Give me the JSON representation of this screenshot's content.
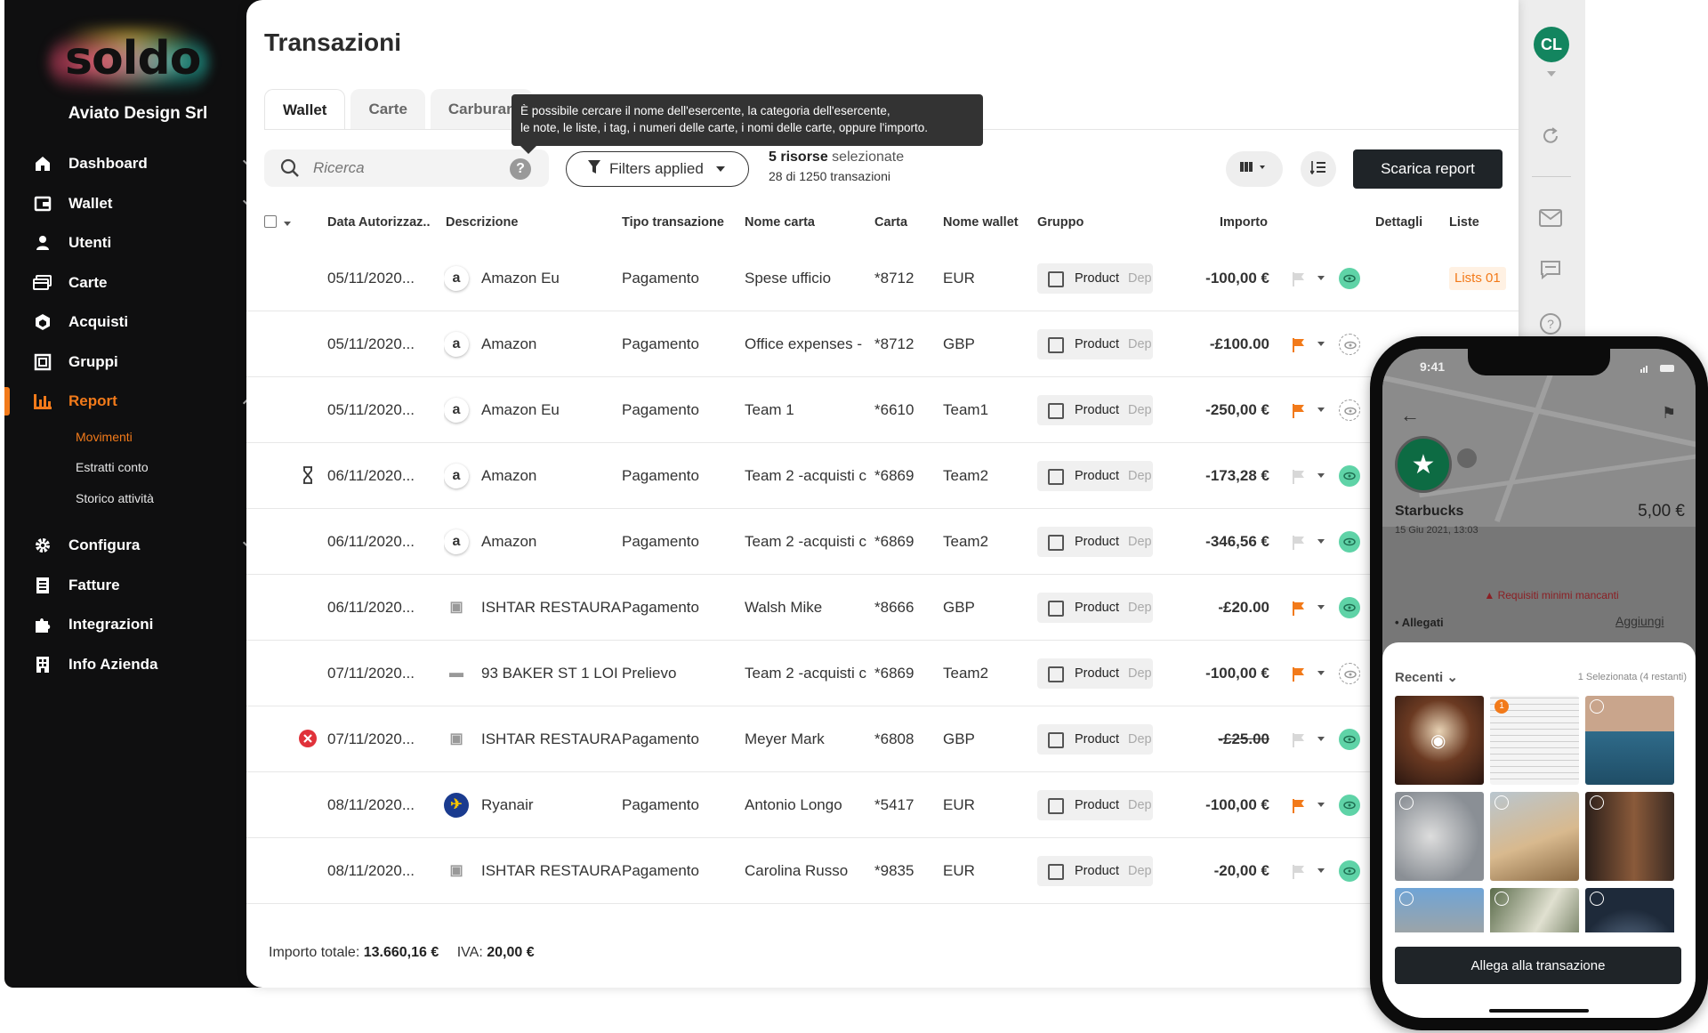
{
  "brand": {
    "logo_text": "soldo",
    "company": "Aviato Design Srl",
    "accent": "#f27a1a"
  },
  "nav": {
    "items": [
      {
        "label": "Dashboard"
      },
      {
        "label": "Wallet"
      },
      {
        "label": "Utenti"
      },
      {
        "label": "Carte"
      },
      {
        "label": "Acquisti"
      },
      {
        "label": "Gruppi"
      },
      {
        "label": "Report"
      },
      {
        "label": "Configura"
      },
      {
        "label": "Fatture"
      },
      {
        "label": "Integrazioni"
      },
      {
        "label": "Info Azienda"
      }
    ],
    "report_sub": [
      {
        "label": "Movimenti"
      },
      {
        "label": "Estratti conto"
      },
      {
        "label": "Storico attività"
      }
    ]
  },
  "page": {
    "title": "Transazioni"
  },
  "tabs": [
    {
      "label": "Wallet"
    },
    {
      "label": "Carte"
    },
    {
      "label": "Carburan"
    }
  ],
  "tooltip": {
    "line1": "È possibile cercare il nome dell'esercente, la categoria dell'esercente,",
    "line2": "le note, le liste, i tag, i numeri delle carte, i nomi delle carte, oppure l'importo."
  },
  "toolbar": {
    "search_placeholder": "Ricerca",
    "help": "?",
    "filters": "Filters applied",
    "resources_count": "5 risorse",
    "resources_suffix": " selezionate",
    "tx_count": "28 di 1250 transazioni",
    "download": "Scarica report"
  },
  "columns": {
    "date": "Data Autorizzaz..",
    "desc": "Descrizione",
    "type": "Tipo transazione",
    "card_name": "Nome carta",
    "card": "Carta",
    "wallet": "Nome wallet",
    "group": "Gruppo",
    "amount": "Importo",
    "details": "Dettagli",
    "lists": "Liste"
  },
  "rows": [
    {
      "status": "",
      "date": "05/11/2020...",
      "icon": "a",
      "merchant": "Amazon Eu",
      "type": "Pagamento",
      "card_name": "Spese ufficio",
      "card": "*8712",
      "wallet": "EUR",
      "group": "Product",
      "group2": "Dep",
      "amount": "-100,00 €",
      "flag": "grey",
      "receipt": "green",
      "list": "Lists 01"
    },
    {
      "status": "",
      "date": "05/11/2020...",
      "icon": "a",
      "merchant": "Amazon",
      "type": "Pagamento",
      "card_name": "Office expenses - ",
      "card": "*8712",
      "wallet": "GBP",
      "group": "Product",
      "group2": "Dep",
      "amount": "-£100.00",
      "flag": "orange",
      "receipt": "outline",
      "list": ""
    },
    {
      "status": "",
      "date": "05/11/2020...",
      "icon": "a",
      "merchant": "Amazon Eu",
      "type": "Pagamento",
      "card_name": "Team 1",
      "card": "*6610",
      "wallet": "Team1",
      "group": "Product",
      "group2": "Dep",
      "amount": "-250,00 €",
      "flag": "orange",
      "receipt": "outline",
      "list": ""
    },
    {
      "status": "hourglass",
      "date": "06/11/2020...",
      "icon": "a",
      "merchant": "Amazon",
      "type": "Pagamento",
      "card_name": "Team 2 -acquisti c",
      "card": "*6869",
      "wallet": "Team2",
      "group": "Product",
      "group2": "Dep",
      "amount": "-173,28 €",
      "flag": "grey",
      "receipt": "green",
      "list": ""
    },
    {
      "status": "",
      "date": "06/11/2020...",
      "icon": "a",
      "merchant": "Amazon",
      "type": "Pagamento",
      "card_name": "Team 2 -acquisti c",
      "card": "*6869",
      "wallet": "Team2",
      "group": "Product",
      "group2": "Dep",
      "amount": "-346,56 €",
      "flag": "grey",
      "receipt": "green",
      "list": ""
    },
    {
      "status": "",
      "date": "06/11/2020...",
      "icon": "restaurant",
      "merchant": "ISHTAR RESTAURA",
      "type": "Pagamento",
      "card_name": "Walsh Mike",
      "card": "*8666",
      "wallet": "GBP",
      "group": "Product",
      "group2": "Dep",
      "amount": "-£20.00",
      "flag": "orange",
      "receipt": "green",
      "list": ""
    },
    {
      "status": "",
      "date": "07/11/2020...",
      "icon": "cash",
      "merchant": "93 BAKER ST 1 LOI",
      "type": "Prelievo",
      "card_name": "Team 2 -acquisti c",
      "card": "*6869",
      "wallet": "Team2",
      "group": "Product",
      "group2": "Dep",
      "amount": "-100,00 €",
      "flag": "orange",
      "receipt": "outline",
      "list": ""
    },
    {
      "status": "error",
      "date": "07/11/2020...",
      "icon": "restaurant",
      "merchant": "ISHTAR RESTAURA",
      "type": "Pagamento",
      "card_name": "Meyer Mark",
      "card": "*6808",
      "wallet": "GBP",
      "group": "Product",
      "group2": "Dep",
      "amount": "-£25.00",
      "flag": "grey",
      "receipt": "green",
      "list": ""
    },
    {
      "status": "",
      "date": "08/11/2020...",
      "icon": "ryanair",
      "merchant": "Ryanair",
      "type": "Pagamento",
      "card_name": "Antonio Longo",
      "card": "*5417",
      "wallet": "EUR",
      "group": "Product",
      "group2": "Dep",
      "amount": "-100,00 €",
      "flag": "orange",
      "receipt": "green",
      "list": ""
    },
    {
      "status": "",
      "date": "08/11/2020...",
      "icon": "restaurant",
      "merchant": "ISHTAR RESTAURA",
      "type": "Pagamento",
      "card_name": "Carolina Russo",
      "card": "*9835",
      "wallet": "EUR",
      "group": "Product",
      "group2": "Dep",
      "amount": "-20,00 €",
      "flag": "grey",
      "receipt": "green",
      "list": ""
    }
  ],
  "totals": {
    "label": "Importo totale:",
    "value": "13.660,16 €",
    "vat_label": "IVA:",
    "vat_value": "20,00 €"
  },
  "user": {
    "initials": "CL"
  },
  "phone": {
    "time": "9:41",
    "merchant": "Starbucks",
    "amount": "5,00 €",
    "date": "15 Giu 2021, 13:03",
    "warning": "Requisiti minimi mancanti",
    "attachments_label": "Allegati",
    "add_label": "Aggiungi",
    "recent_label": "Recenti",
    "selected_label": "1 Selezionata (4 restanti)",
    "attach_button": "Allega alla transazione"
  }
}
